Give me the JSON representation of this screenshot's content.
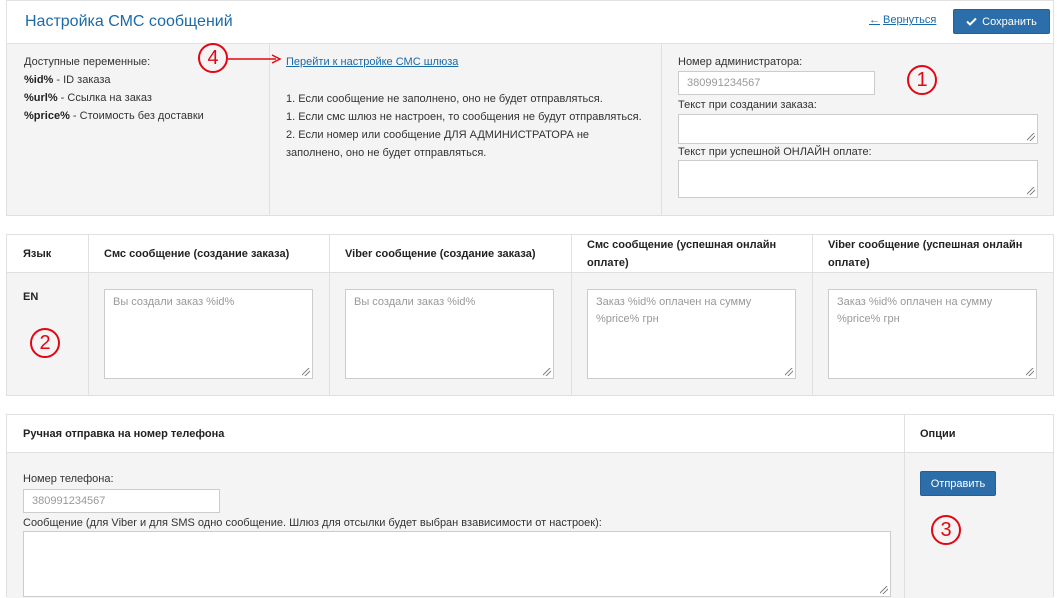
{
  "header": {
    "title": "Настройка СМС сообщений",
    "back_label": "Вернуться",
    "back_icon": "arrow-left-icon",
    "save_label": "Сохранить",
    "save_icon": "check-icon",
    "accent_color": "#2c6eaa"
  },
  "variables": {
    "heading": "Доступные переменные:",
    "items": [
      {
        "name": "%id%",
        "desc": " - ID заказа"
      },
      {
        "name": "%url%",
        "desc": " - Ссылка на заказ"
      },
      {
        "name": "%price%",
        "desc": " - Стоимость без доставки"
      }
    ]
  },
  "gateway": {
    "link_label": "Перейти к настройке СМС шлюза",
    "notes": [
      "1. Если сообщение не заполнено, оно не будет отправляться.",
      "1. Если смс шлюз не настроен, то сообщения не будут отправляться.",
      "2. Если номер или сообщение ДЛЯ АДМИНИСТРАТОРА не заполнено, оно не будет отправляться."
    ]
  },
  "admin": {
    "phone_label": "Номер администратора:",
    "phone_placeholder": "380991234567",
    "order_text_label": "Текст при создании заказа:",
    "order_text_value": "",
    "payment_text_label": "Текст при успешной ОНЛАЙН оплате:",
    "payment_text_value": ""
  },
  "language_table": {
    "headers": [
      "Язык",
      "Смс сообщение (создание заказа)",
      "Viber сообщение (создание заказа)",
      "Смс сообщение (успешная онлайн оплате)",
      "Viber сообщение (успешная онлайн оплате)"
    ],
    "rows": [
      {
        "lang": "EN",
        "sms_create": "Вы создали заказ %id%",
        "viber_create": "Вы создали заказ %id%",
        "sms_paid": "Заказ %id% оплачен на сумму %price% грн",
        "viber_paid": "Заказ %id% оплачен на сумму %price% грн"
      }
    ]
  },
  "manual": {
    "title": "Ручная отправка на номер телефона",
    "options_title": "Опции",
    "phone_label": "Номер телефона:",
    "phone_placeholder": "380991234567",
    "message_label": "Сообщение (для Viber и для SMS одно сообщение. Шлюз для отсылки будет выбран взависимости от настроек):",
    "message_value": "",
    "send_label": "Отправить"
  },
  "annotations": {
    "marker_1": "1",
    "marker_2": "2",
    "marker_3": "3",
    "marker_4": "4",
    "marker_color": "#e30613"
  }
}
